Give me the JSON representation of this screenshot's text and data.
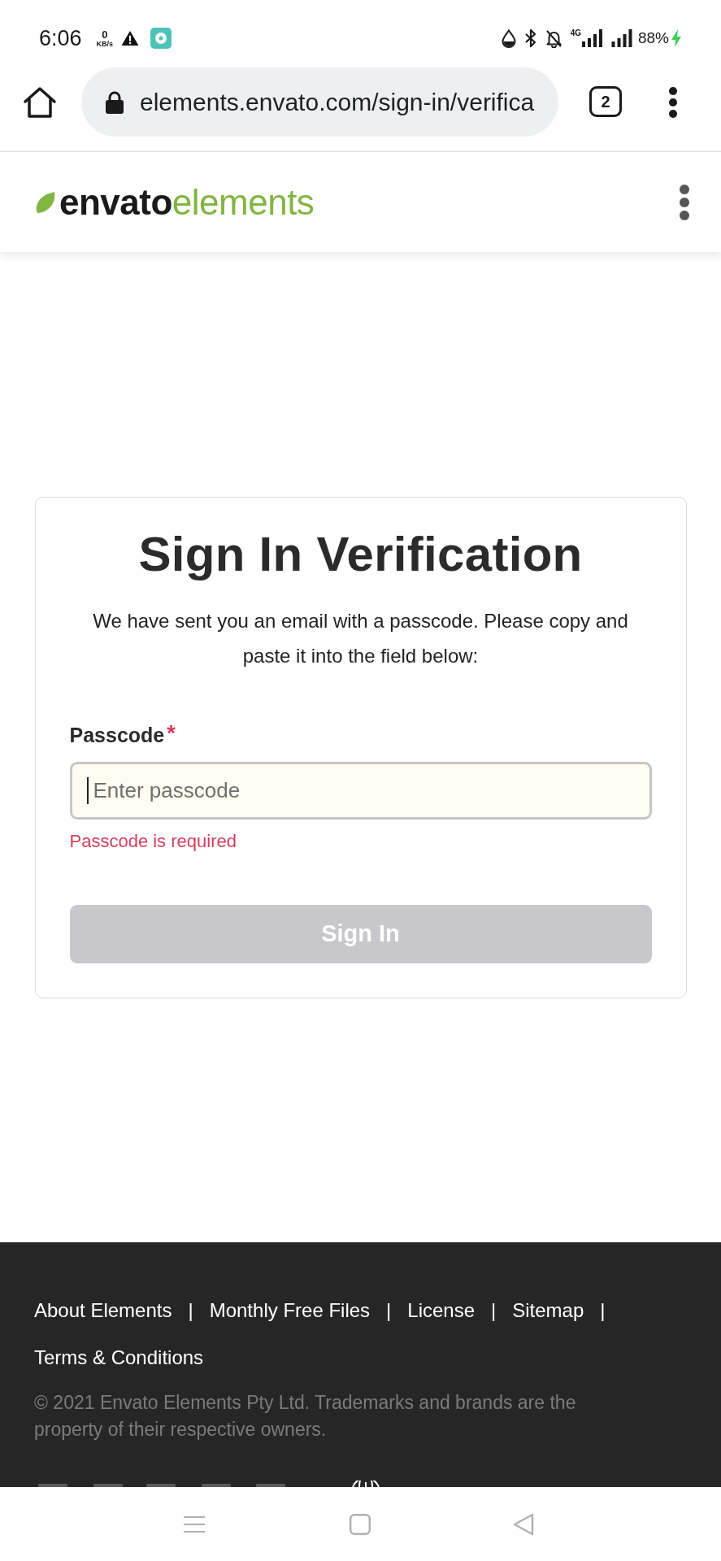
{
  "status_bar": {
    "time": "6:06",
    "net_speed": "0",
    "net_speed_unit": "KB/s",
    "network_type": "4G",
    "battery": "88%",
    "charging": true
  },
  "browser": {
    "url": "elements.envato.com/sign-in/verifica",
    "tab_count": "2"
  },
  "header": {
    "logo": {
      "brand": "envato",
      "product": "elements"
    }
  },
  "card": {
    "title": "Sign In Verification",
    "message": "We have sent you an email with a passcode. Please copy and paste it into the field below:",
    "field": {
      "label": "Passcode",
      "required_mark": "*",
      "placeholder": "Enter passcode",
      "focused": true,
      "error": "Passcode is required"
    },
    "button": {
      "label": "Sign In",
      "disabled": true
    }
  },
  "footer": {
    "links": [
      {
        "label": "About Elements",
        "separator": "|"
      },
      {
        "label": "Monthly Free Files",
        "separator": "|"
      },
      {
        "label": "License",
        "separator": "|"
      },
      {
        "label": "Sitemap",
        "separator": "|"
      },
      {
        "label": "Terms & Conditions"
      }
    ],
    "copyright": "© 2021 Envato Elements Pty Ltd. Trademarks and brands are the property of their respective owners."
  }
}
